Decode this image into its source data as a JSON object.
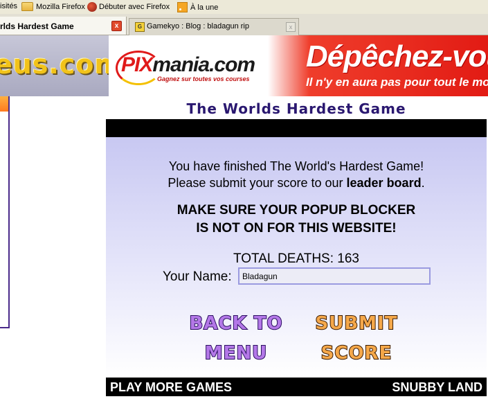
{
  "bookmarks": [
    {
      "label": "isités",
      "icon": ""
    },
    {
      "label": "Mozilla Firefox",
      "icon": "folder-icon"
    },
    {
      "label": "Débuter avec Firefox",
      "icon": "firefox-icon"
    },
    {
      "label": "À la une",
      "icon": "rss-icon"
    }
  ],
  "tabs": [
    {
      "title": "rlds Hardest Game",
      "active": true,
      "close": "x"
    },
    {
      "title": "Gamekyo : Blog : bladagun rip",
      "active": false,
      "favicon": "G",
      "close": "x"
    }
  ],
  "banner": {
    "site_logo": "eus.com",
    "ad_brand_pix": "PIX",
    "ad_brand_rest": "mania.com",
    "ad_tagline": "Gagnez sur toutes vos courses",
    "ad_headline": "Dépêchez-vous !",
    "ad_subline": "Il n'y en aura pas pour tout le monde"
  },
  "game": {
    "title": "The Worlds Hardest Game",
    "message_line1": "You have finished The World's Hardest Game!",
    "message_line2_prefix": "Please submit your score to our ",
    "message_line2_bold": "leader board",
    "message_line2_suffix": ".",
    "warning_line1": "MAKE SURE YOUR POPUP BLOCKER",
    "warning_line2": "IS NOT ON FOR THIS WEBSITE!",
    "deaths": "TOTAL DEATHS: 163",
    "name_label": "Your Name:",
    "name_value": "Bladagun",
    "back_line1": "BACK TO",
    "back_line2": "MENU",
    "submit_line1": "SUBMIT",
    "submit_line2": "SCORE",
    "footer_left": "PLAY MORE GAMES",
    "footer_right": "SNUBBY LAND"
  },
  "colors": {
    "title": "#2a1870",
    "back_button": "#b478e8",
    "submit_button": "#f5a84a",
    "ad_red": "#e21b14"
  }
}
